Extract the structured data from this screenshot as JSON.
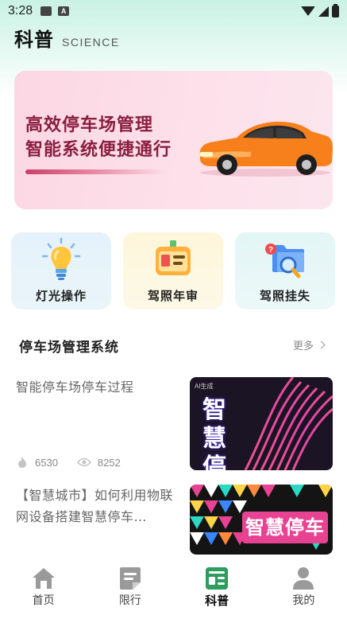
{
  "status": {
    "time": "3:28",
    "notif_a": "A"
  },
  "header": {
    "title": "科普",
    "subtitle": "SCIENCE"
  },
  "banner": {
    "line1": "高效停车场管理",
    "line2": "智能系统便捷通行"
  },
  "tiles": [
    {
      "label": "灯光操作",
      "icon": "lightbulb-icon"
    },
    {
      "label": "驾照年审",
      "icon": "id-card-icon"
    },
    {
      "label": "驾照挂失",
      "icon": "folder-search-icon"
    }
  ],
  "section": {
    "title": "停车场管理系统",
    "more": "更多"
  },
  "articles": [
    {
      "title": "智能停车场停车过程",
      "likes": "6530",
      "views": "8252",
      "thumb_text": "智慧停车",
      "thumb_badge": "AI生成"
    },
    {
      "title": "【智慧城市】如何利用物联网设备搭建智慧停车…",
      "thumb_text": "智慧停车"
    }
  ],
  "tabs": [
    {
      "label": "首页",
      "icon": "home-icon"
    },
    {
      "label": "限行",
      "icon": "note-icon"
    },
    {
      "label": "科普",
      "icon": "news-icon",
      "active": true
    },
    {
      "label": "我的",
      "icon": "user-icon"
    }
  ],
  "colors": {
    "accent": "#2e9b5f",
    "banner_text": "#8a1e3f",
    "icon_gray": "#9a9a9a"
  }
}
